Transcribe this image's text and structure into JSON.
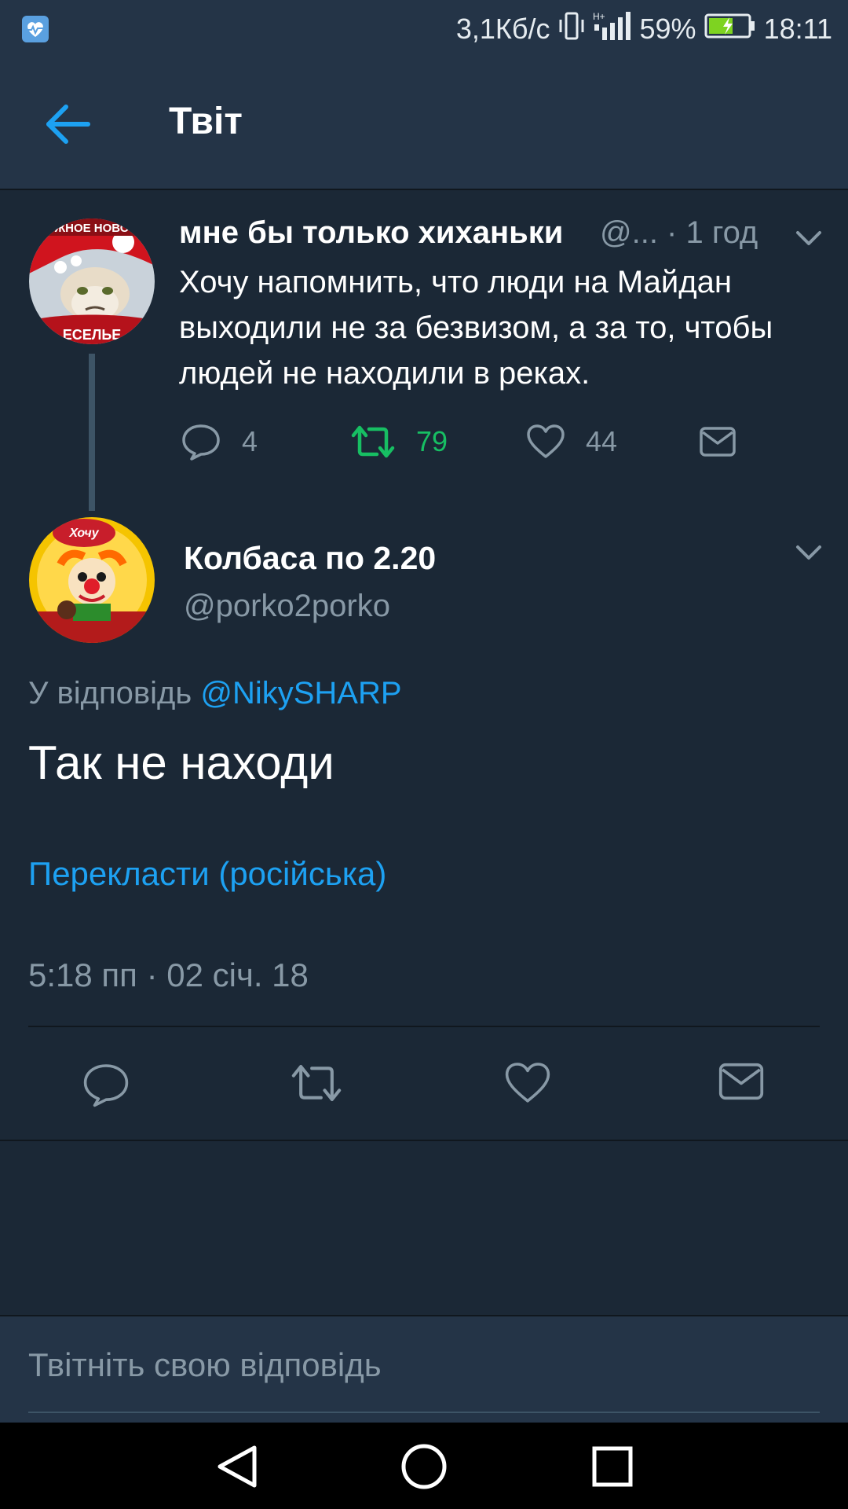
{
  "status_bar": {
    "network_speed": "3,1Кб/с",
    "battery_percent": "59%",
    "time": "18:11"
  },
  "header": {
    "title": "Твіт"
  },
  "parent_tweet": {
    "author_name": "мне бы только хиханьки",
    "meta": "@... · 1 год",
    "text": "Хочу напомнить, что люди на Майдан выходили не за безвизом, а за то, чтобы людей не находили в реках.",
    "reply_count": "4",
    "retweet_count": "79",
    "like_count": "44",
    "avatar_caption_top": "ЖНОЕ НОВО",
    "avatar_caption_bottom": "ЕСЕЛЬЕ"
  },
  "main_tweet": {
    "author_name": "Колбаса по 2.20",
    "handle": "@porko2porko",
    "reply_label": "У відповідь",
    "reply_mention": "@NikySHARP",
    "text": "Так не находи",
    "translate_label": "Перекласти (російська)",
    "timestamp": "5:18 пп · 02 січ. 18",
    "avatar_caption": "Хочу"
  },
  "reply_box": {
    "placeholder": "Твітніть свою відповідь"
  },
  "colors": {
    "background": "#1b2836",
    "header": "#243447",
    "accent": "#1da1f2",
    "retweet_active": "#17bf63",
    "muted": "#8899a6"
  },
  "icons": [
    "back-arrow-icon",
    "chevron-down-icon",
    "reply-icon",
    "retweet-icon",
    "like-icon",
    "message-icon",
    "nav-back-icon",
    "nav-home-icon",
    "nav-recents-icon"
  ]
}
